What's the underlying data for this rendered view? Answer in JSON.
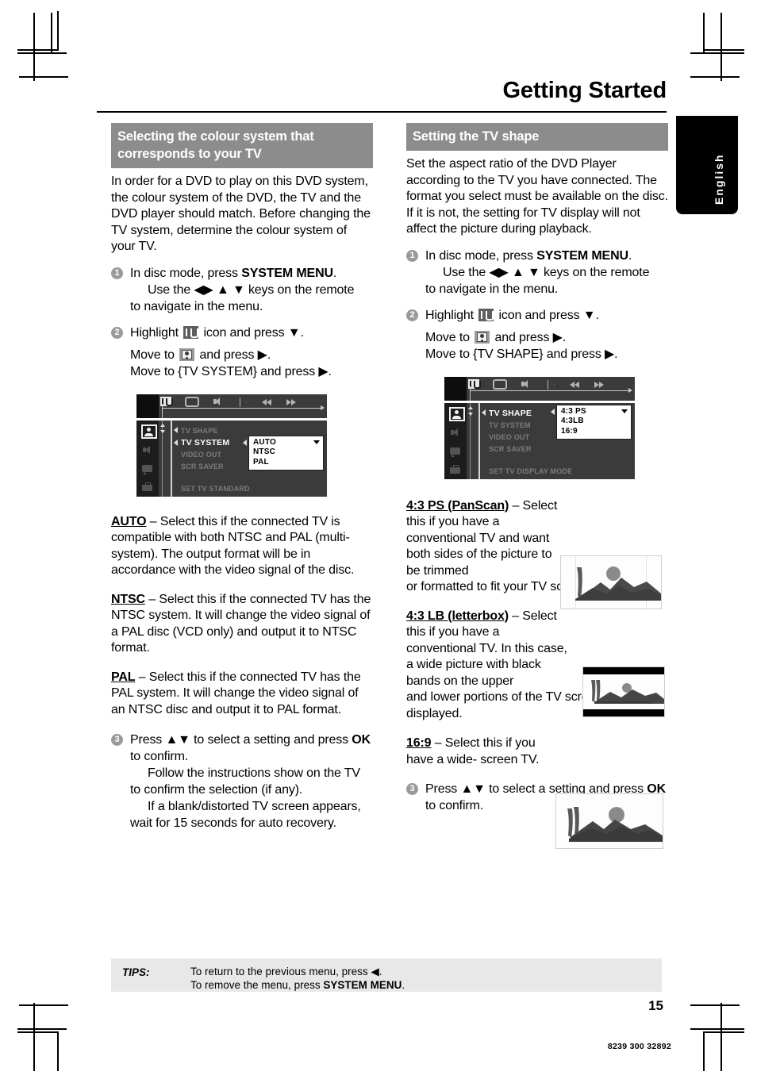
{
  "page": {
    "title": "Getting Started",
    "language_tab": "English",
    "page_number": "15",
    "document_code": "8239 300 32892"
  },
  "left_column": {
    "heading": "Selecting the colour system that corresponds to your TV",
    "intro": "In order for a DVD to play on this DVD system, the colour system of the DVD, the TV and the DVD player should match. Before changing the TV system, determine the colour system of your TV.",
    "steps": [
      {
        "num": "1",
        "line1_pre": "In disc mode, press ",
        "line1_bold": "SYSTEM MENU",
        "line1_post": ".",
        "line2": "Use the ◀▶ ▲ ▼ keys on the remote",
        "line3": "to navigate in the menu."
      },
      {
        "num": "2",
        "highlight_pre": "Highlight ",
        "highlight_post": " icon and press ▼.",
        "move1_pre": "Move to ",
        "move1_post": " and press ▶.",
        "move2": "Move to {TV SYSTEM} and press ▶."
      },
      {
        "num": "3",
        "line1_pre": "Press ▲▼ to select a setting and press ",
        "line1_bold": "OK",
        "line1_post": " to confirm.",
        "line2": "Follow the instructions show on the TV to confirm the selection (if any).",
        "line3": "If a blank/distorted TV screen appears, wait for 15 seconds for auto recovery."
      }
    ],
    "osd": {
      "toolbar_icons": [
        "tools-icon",
        "display-icon",
        "audio-icon",
        "play-icon",
        "rewind-icon",
        "forward-icon"
      ],
      "rail_icons": [
        "display-settings-icon",
        "audio-settings-icon",
        "language-settings-icon",
        "preferences-icon"
      ],
      "menu_items": [
        {
          "label": "TV SHAPE",
          "active": false
        },
        {
          "label": "TV SYSTEM",
          "active": true
        },
        {
          "label": "VIDEO OUT",
          "active": false
        },
        {
          "label": "SCR SAVER",
          "active": false
        }
      ],
      "footer": "SET TV STANDARD",
      "dropdown_options": [
        "AUTO",
        "NTSC",
        "PAL"
      ]
    },
    "definitions": [
      {
        "term": "AUTO",
        "text": " – Select this if the connected TV is compatible with both NTSC and PAL (multi-system). The output format will be in accordance with the video signal of the disc."
      },
      {
        "term": "NTSC",
        "text": " – Select this if the connected TV has the NTSC system. It will change the video signal of a PAL disc (VCD only) and output it to NTSC format."
      },
      {
        "term": "PAL",
        "text": " – Select this if the connected TV has the PAL system. It will change the video signal of an NTSC disc and output it to PAL format."
      }
    ]
  },
  "right_column": {
    "heading": "Setting the TV shape",
    "intro": "Set the aspect ratio of the DVD Player according to the TV you have connected. The format you select must be available on the disc.  If it is not, the setting for TV display will not affect the picture during playback.",
    "steps": [
      {
        "num": "1",
        "line1_pre": "In disc mode, press ",
        "line1_bold": "SYSTEM MENU",
        "line1_post": ".",
        "line2": "Use the ◀▶ ▲ ▼ keys on the remote",
        "line3": "to navigate in the menu."
      },
      {
        "num": "2",
        "highlight_pre": "Highlight ",
        "highlight_post": " icon and press ▼.",
        "move1_pre": "Move to ",
        "move1_post": " and press ▶.",
        "move2": "Move to {TV SHAPE} and press ▶."
      },
      {
        "num": "3",
        "line1_pre": "Press ▲▼ to select a ",
        "line1_mid": "setting and press ",
        "line1_bold": "OK",
        "line1_post": " to confirm."
      }
    ],
    "osd": {
      "toolbar_icons": [
        "tools-icon",
        "display-icon",
        "audio-icon",
        "play-icon",
        "rewind-icon",
        "forward-icon"
      ],
      "rail_icons": [
        "display-settings-icon",
        "audio-settings-icon",
        "language-settings-icon",
        "preferences-icon"
      ],
      "menu_items": [
        {
          "label": "TV SHAPE",
          "active": true
        },
        {
          "label": "TV SYSTEM",
          "active": false
        },
        {
          "label": "VIDEO OUT",
          "active": false
        },
        {
          "label": "SCR SAVER",
          "active": false
        }
      ],
      "footer": "SET TV DISPLAY MODE",
      "dropdown_options": [
        "4:3 PS",
        "4:3LB",
        "16:9"
      ]
    },
    "definitions": [
      {
        "term": "4:3 PS (PanScan)",
        "text_wrapped": " – Select this if you have a conventional TV and want both sides of the picture to be trimmed",
        "text_full": " – Select this if you have a conventional TV and want both sides of the picture to be trimmed or formatted to fit your TV screen.",
        "tail": "or formatted to fit your TV screen.",
        "thumb": "panscan-thumbnail"
      },
      {
        "term": "4:3 LB (letterbox)",
        "text_wrapped": " – Select this if you have a conventional TV. In this case, a wide picture with black bands on the upper",
        "text_full": " – Select this if you have a conventional TV. In this case, a wide picture with black bands on the upper and lower portions of the TV screen will be displayed.",
        "tail": "and lower portions of the TV screen will be displayed.",
        "thumb": "letterbox-thumbnail"
      },
      {
        "term": "16:9",
        "text_wrapped": "  – Select this if you have a wide- screen TV.",
        "text_full": "  – Select this if you have a wide-screen TV.",
        "tail": "",
        "thumb": "widescreen-thumbnail"
      }
    ]
  },
  "tips": {
    "label": "TIPS:",
    "line1": "To return to the previous menu, press ◀.",
    "line2_pre": "To remove the menu, press ",
    "line2_bold": "SYSTEM MENU",
    "line2_post": "."
  },
  "colors": {
    "heading_bar": "#8c8c8c",
    "tips_bar": "#e8e8e8",
    "step_bullet": "#9a9a9a",
    "osd_background": "#3b3b3b",
    "osd_rail": "#1c1c1c",
    "lang_tab": "#000000"
  }
}
